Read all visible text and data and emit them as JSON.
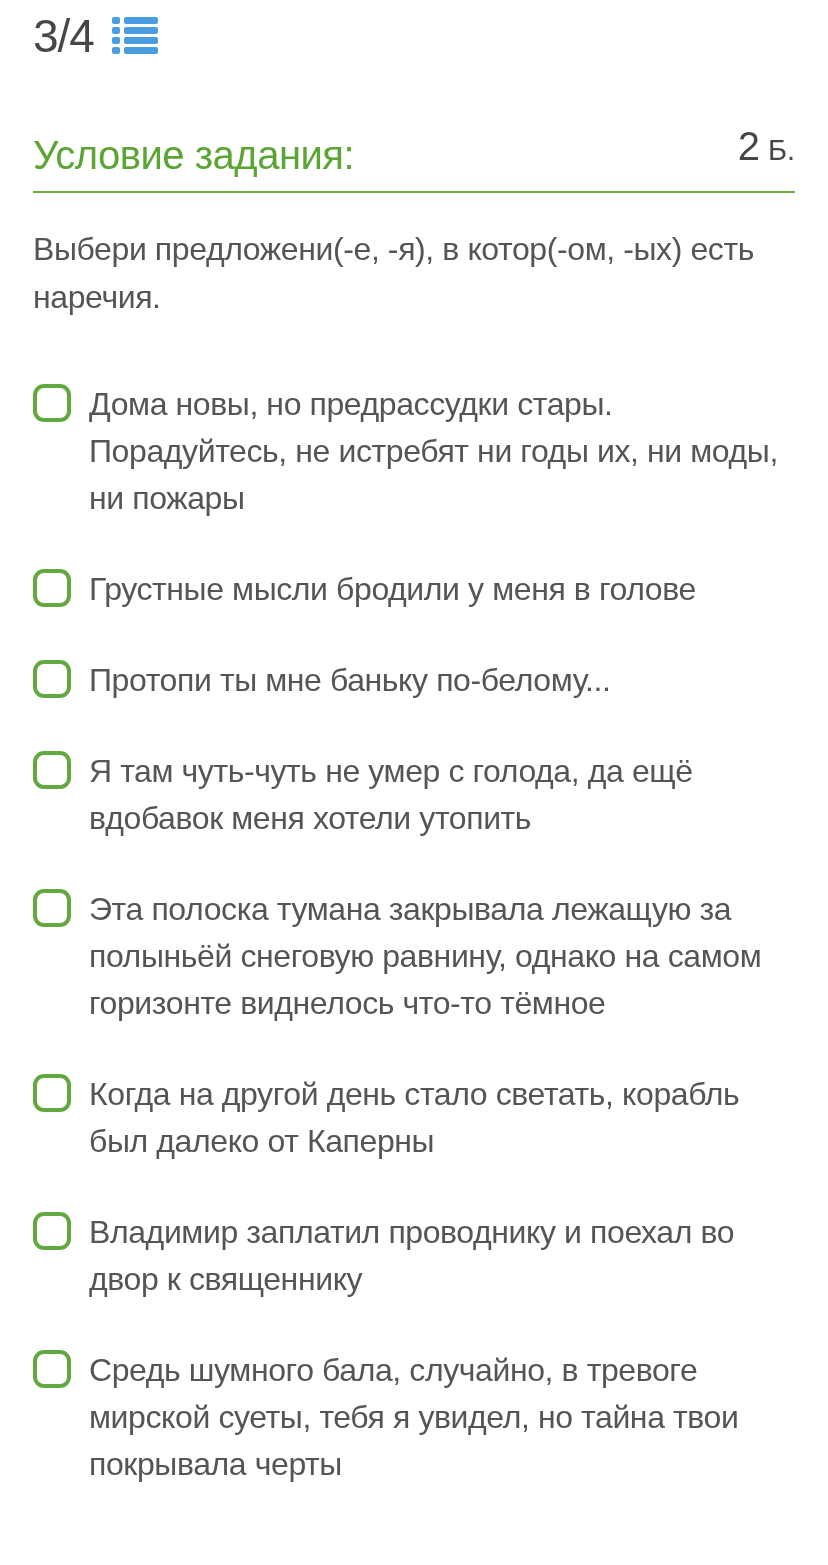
{
  "progress": {
    "counter": "3/4"
  },
  "task": {
    "heading": "Условие задания:",
    "points_value": "2",
    "points_unit": "Б."
  },
  "instruction": "Выбери предложени(-е, -я), в котор(-ом, -ых) есть наречия.",
  "options": [
    {
      "text": "Дома новы, но предрассудки стары. Порадуйтесь, не истребят ни годы их, ни моды, ни пожары",
      "checked": false
    },
    {
      "text": "Грустные мысли бродили у меня в голове",
      "checked": false
    },
    {
      "text": "Протопи ты мне баньку по-белому...",
      "checked": false
    },
    {
      "text": "Я там чуть-чуть не умер с голода, да ещё вдобавок меня хотели утопить",
      "checked": false
    },
    {
      "text": "Эта полоска тумана закрывала лежащую за полыньёй снеговую равнину, однако на самом горизонте виднелось что-то тёмное",
      "checked": false
    },
    {
      "text": "Когда на другой день стало светать, корабль был далеко от Каперны",
      "checked": false
    },
    {
      "text": "Владимир заплатил проводнику и поехал во двор к священнику",
      "checked": false
    },
    {
      "text": "Средь шумного бала, случайно, в тревоге мирской суеты, тебя я увидел, но тайна твои покрывала черты",
      "checked": false
    }
  ]
}
